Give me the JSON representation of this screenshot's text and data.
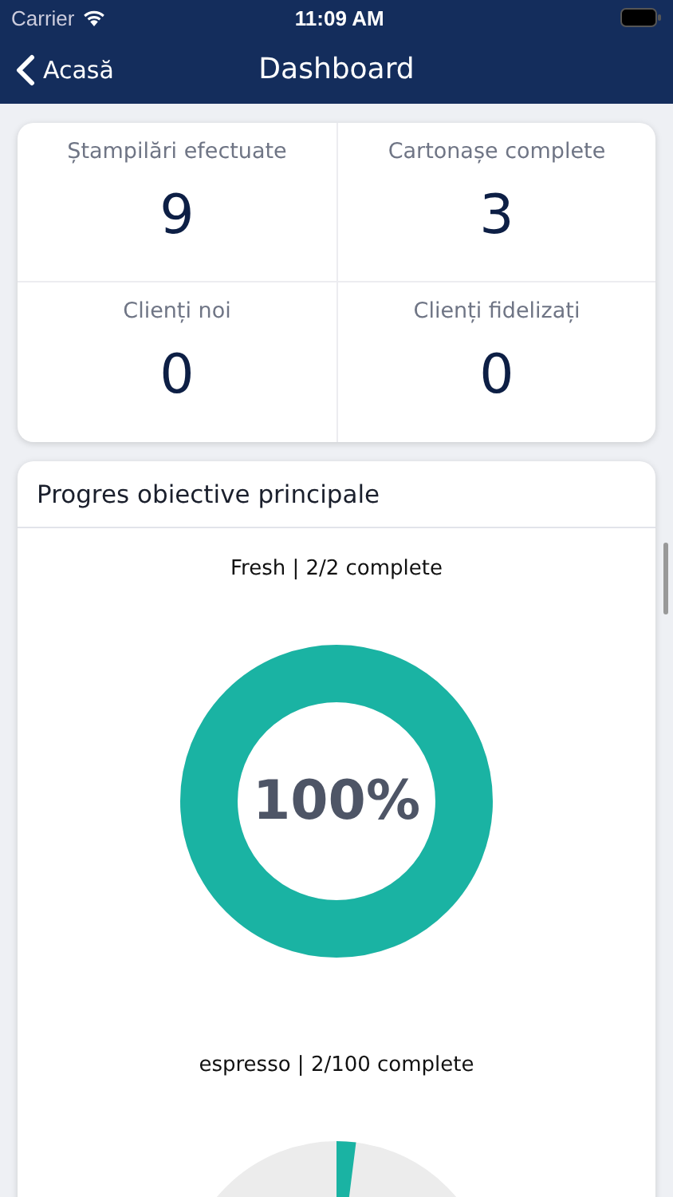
{
  "status_bar": {
    "carrier": "Carrier",
    "time": "11:09 AM"
  },
  "nav": {
    "back_label": "Acasă",
    "title": "Dashboard"
  },
  "stats": [
    {
      "label": "Ștampilări efectuate",
      "value": "9"
    },
    {
      "label": "Cartonașe complete",
      "value": "3"
    },
    {
      "label": "Clienți noi",
      "value": "0"
    },
    {
      "label": "Clienți fidelizați",
      "value": "0"
    }
  ],
  "goals_panel": {
    "title": "Progres obiective principale",
    "goals": [
      {
        "label": "Fresh | 2/2 complete",
        "level": 1,
        "percent": "100%"
      },
      {
        "label": "espresso | 2/100 complete",
        "level": 0.02
      }
    ]
  }
}
